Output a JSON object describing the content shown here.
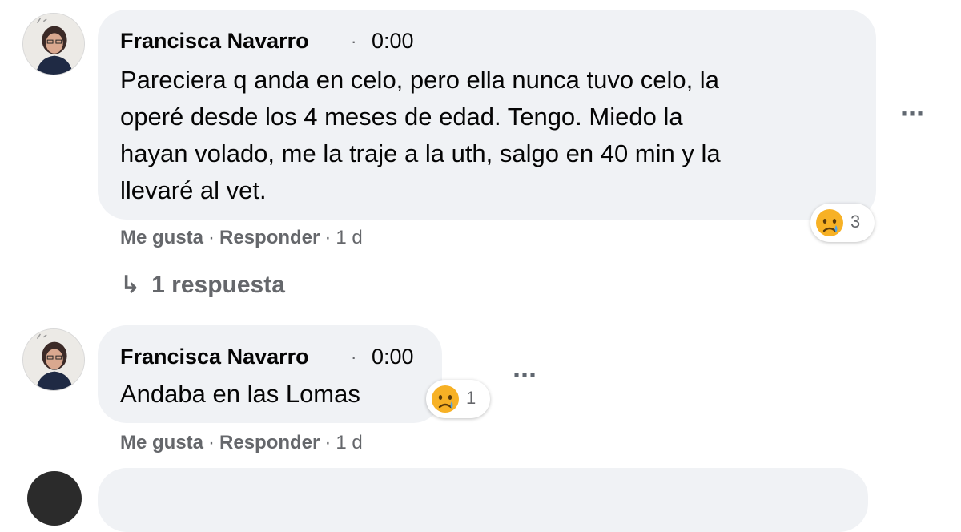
{
  "comments": [
    {
      "author": "Francisca Navarro",
      "separator": "·",
      "time": "0:00",
      "lines": [
        "Pareciera q anda en celo, pero ella nunca tuvo celo, la",
        "operé desde los 4 meses de edad. Tengo. Miedo la",
        "hayan volado, me la traje a la uth, salgo en 40 min y la",
        "llevaré al vet."
      ],
      "actions": {
        "like": "Me gusta",
        "reply": "Responder",
        "sep": "·",
        "age": "1 d"
      },
      "reaction": {
        "icon": "sad-crying-face-icon",
        "count": "3"
      },
      "more": "···"
    },
    {
      "author": "Francisca Navarro",
      "separator": "·",
      "time": "0:00",
      "lines": [
        "Andaba en las Lomas"
      ],
      "actions": {
        "like": "Me gusta",
        "reply": "Responder",
        "sep": "·",
        "age": "1 d"
      },
      "reaction": {
        "icon": "sad-crying-face-icon",
        "count": "1"
      },
      "more": "···"
    }
  ],
  "replies_link": {
    "arrow": "↳",
    "label": "1 respuesta"
  },
  "colors": {
    "bubble": "#f0f2f5",
    "secondary_text": "#65676b",
    "emoji_face": "#f7b125"
  }
}
